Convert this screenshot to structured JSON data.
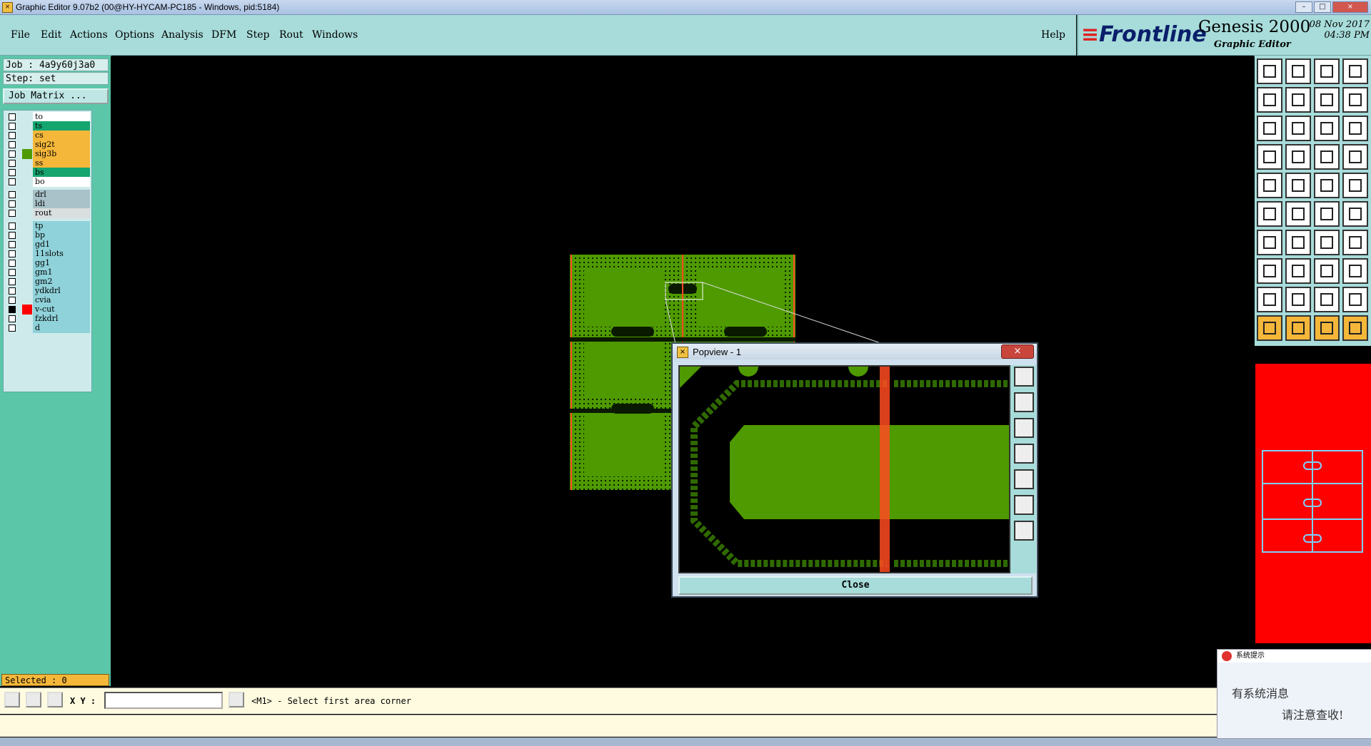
{
  "window": {
    "title": "Graphic Editor 9.07b2 (00@HY-HYCAM-PC185 - Windows, pid:5184)"
  },
  "menu": {
    "items": [
      "File",
      "Edit",
      "Actions",
      "Options",
      "Analysis",
      "DFM",
      "Step",
      "Rout",
      "Windows"
    ],
    "help": "Help"
  },
  "brand": {
    "logo": "Frontline",
    "product": "Genesis 2000",
    "subtitle": "Graphic Editor",
    "date": "08 Nov 2017",
    "time": "04:38 PM"
  },
  "job": {
    "job_label": "Job : 4a9y60j3a0",
    "step_label": "Step: set",
    "matrix_button": "Job Matrix ..."
  },
  "layers": [
    {
      "name": "to",
      "color": "#ffffff"
    },
    {
      "name": "ts",
      "color": "#15a56f"
    },
    {
      "name": "cs",
      "color": "#f4b73a"
    },
    {
      "name": "sig2t",
      "color": "#f4b73a"
    },
    {
      "name": "sig3b",
      "color": "#f4b73a",
      "active": true
    },
    {
      "name": "ss",
      "color": "#f4b73a"
    },
    {
      "name": "bs",
      "color": "#15a56f"
    },
    {
      "name": "bo",
      "color": "#ffffff"
    },
    {
      "name": "drl",
      "color": "#a9c2c9"
    },
    {
      "name": "ldi",
      "color": "#a9c2c9"
    },
    {
      "name": "rout",
      "color": "#d9dede"
    },
    {
      "name": "tp",
      "color": "#8fd2da"
    },
    {
      "name": "bp",
      "color": "#8fd2da"
    },
    {
      "name": "gd1",
      "color": "#8fd2da"
    },
    {
      "name": "11slots",
      "color": "#8fd2da"
    },
    {
      "name": "gg1",
      "color": "#8fd2da"
    },
    {
      "name": "gm1",
      "color": "#8fd2da"
    },
    {
      "name": "gm2",
      "color": "#8fd2da"
    },
    {
      "name": "ydkdrl",
      "color": "#8fd2da"
    },
    {
      "name": "cvia",
      "color": "#8fd2da"
    },
    {
      "name": "v-cut",
      "color": "#8fd2da",
      "swatch": "#ff0000",
      "checked": true
    },
    {
      "name": "fzkdrl",
      "color": "#8fd2da"
    },
    {
      "name": "d",
      "color": "#8fd2da"
    }
  ],
  "status": {
    "selected": "Selected : 0",
    "xy_label": "X Y :",
    "xy_value": "",
    "message": "<M1> - Select first area corner"
  },
  "popview": {
    "title": "Popview - 1",
    "close_label": "Close"
  },
  "notice": {
    "header": "系统提示",
    "line1": "有系统消息",
    "line2": "请注意查收!"
  },
  "colors": {
    "panel": "#a7dcda",
    "board_green": "#4e9a00",
    "layer_active": "#ff0000"
  },
  "icons": {
    "tools": [
      "zoom-in-icon",
      "zoom-out-icon",
      "home-icon",
      "window-icon",
      "pan-left-icon",
      "pan-right-icon",
      "undo-icon",
      "redo-icon",
      "fit-icon",
      "zoom-box-icon",
      "ratio-icon",
      "query-icon",
      "measure-icon",
      "snap-icon",
      "layers-icon",
      "layers-alt-icon",
      "pad-icon",
      "line-draw-icon",
      "ruler-icon",
      "circle-icon",
      "node-icon",
      "delete-icon",
      "move-icon",
      "copy-icon",
      "line-icon",
      "arc-icon",
      "rotate-icon",
      "mirror-icon",
      "resize-icon",
      "cut-icon",
      "distance-icon",
      "group-icon",
      "triangle-icon",
      "triangle-alt-icon",
      "text-a-icon",
      "text-b-icon",
      "pointer-icon",
      "pointer-alt-icon",
      "pointer-select-icon",
      "pointer-net-icon"
    ]
  }
}
